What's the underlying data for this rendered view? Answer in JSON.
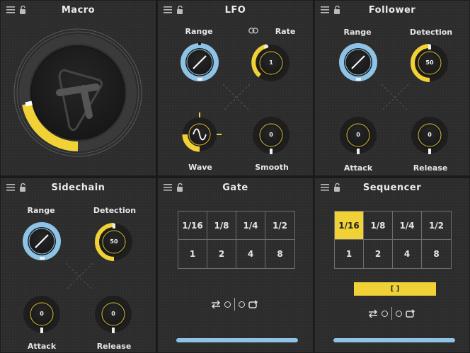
{
  "colors": {
    "blue": "#8ec3e6",
    "yellow": "#f1d236",
    "panel": "#2c2c2c",
    "text": "#e6e6e6"
  },
  "macro": {
    "title": "Macro",
    "level": 0.33
  },
  "lfo": {
    "title": "LFO",
    "range_label": "Range",
    "rate_label": "Rate",
    "rate_value": "1",
    "wave_label": "Wave",
    "smooth_label": "Smooth",
    "smooth_value": "0"
  },
  "follower": {
    "title": "Follower",
    "range_label": "Range",
    "detection_label": "Detection",
    "detection_value": "50",
    "attack_label": "Attack",
    "attack_value": "0",
    "release_label": "Release",
    "release_value": "0"
  },
  "sidechain": {
    "title": "Sidechain",
    "range_label": "Range",
    "detection_label": "Detection",
    "detection_value": "50",
    "attack_label": "Attack",
    "attack_value": "0",
    "release_label": "Release",
    "release_value": "0"
  },
  "gate": {
    "title": "Gate",
    "divisions": [
      "1/16",
      "1/8",
      "1/4",
      "1/2"
    ],
    "multipliers": [
      "1",
      "2",
      "4",
      "8"
    ]
  },
  "sequencer": {
    "title": "Sequencer",
    "divisions": [
      "1/16",
      "1/8",
      "1/4",
      "1/2"
    ],
    "multipliers": [
      "1",
      "2",
      "4",
      "8"
    ],
    "button_label": "[ ]"
  },
  "icons": [
    "menu-icon",
    "lock-icon",
    "link-icon",
    "loop-icon",
    "retrigger-icon",
    "sine-wave-icon"
  ]
}
